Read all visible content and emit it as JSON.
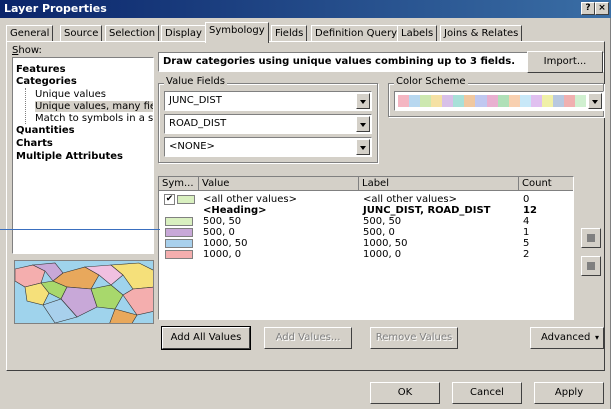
{
  "window": {
    "title": "Layer Properties",
    "help_glyph": "?",
    "close_glyph": "×"
  },
  "tabs": [
    "General",
    "Source",
    "Selection",
    "Display",
    "Symbology",
    "Fields",
    "Definition Query",
    "Labels",
    "Joins & Relates"
  ],
  "active_tab": "Symbology",
  "show": {
    "label": "Show:",
    "items": [
      {
        "label": "Features",
        "bold": true
      },
      {
        "label": "Categories",
        "bold": true
      },
      {
        "label": "Unique values",
        "bold": false
      },
      {
        "label": "Unique values, many fiel",
        "bold": false,
        "selected": true
      },
      {
        "label": "Match to symbols in a sty",
        "bold": false
      },
      {
        "label": "Quantities",
        "bold": true
      },
      {
        "label": "Charts",
        "bold": true
      },
      {
        "label": "Multiple Attributes",
        "bold": true
      }
    ]
  },
  "header": {
    "description": "Draw categories using unique values combining up to 3 fields.",
    "import_label": "Import..."
  },
  "value_fields": {
    "label": "Value Fields",
    "fields": [
      "JUNC_DIST",
      "ROAD_DIST",
      "<NONE>"
    ]
  },
  "color_scheme": {
    "label": "Color Scheme",
    "colors": [
      "#f4b6c2",
      "#b8d8f0",
      "#cde8b0",
      "#f5e1a4",
      "#d8c0e8",
      "#a8e0d8",
      "#f0c8a0",
      "#c0c8f0",
      "#e8b0d0",
      "#b0e0b8",
      "#f8d0b0",
      "#c8e8f8",
      "#e0c0f0",
      "#f0f0a8",
      "#b8c8e0",
      "#f0b0b0",
      "#d0f0d0"
    ]
  },
  "table": {
    "columns": [
      "Sym...",
      "Value",
      "Label",
      "Count"
    ],
    "rows": [
      {
        "type": "check",
        "value": "<all other values>",
        "label": "<all other values>",
        "count": "0",
        "bold": false
      },
      {
        "type": "none",
        "value": "<Heading>",
        "label": "JUNC_DIST, ROAD_DIST",
        "count": "12",
        "bold": true
      },
      {
        "type": "swatch",
        "color": "#d9f0c0",
        "value": "500, 50",
        "label": "500, 50",
        "count": "4",
        "bold": false
      },
      {
        "type": "swatch",
        "color": "#c8a8d8",
        "value": "500, 0",
        "label": "500, 0",
        "count": "1",
        "bold": false
      },
      {
        "type": "swatch",
        "color": "#a8d0ec",
        "value": "1000, 50",
        "label": "1000, 50",
        "count": "5",
        "bold": false
      },
      {
        "type": "swatch",
        "color": "#f4aeae",
        "value": "1000, 0",
        "label": "1000, 0",
        "count": "2",
        "bold": false
      }
    ]
  },
  "buttons": {
    "add_all_values": "Add All Values",
    "add_values": "Add Values...",
    "remove_values": "Remove Values",
    "advanced": "Advanced",
    "ok": "OK",
    "cancel": "Cancel",
    "apply": "Apply"
  }
}
